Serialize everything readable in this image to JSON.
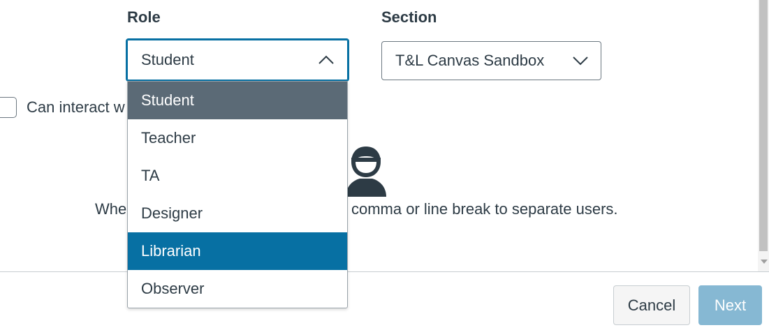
{
  "form": {
    "role_label": "Role",
    "section_label": "Section",
    "role_value": "Student",
    "section_value": "T&L Canvas Sandbox",
    "checkbox_label": "Can interact w",
    "instruction_left": "Whe",
    "instruction_right": "comma or line break to separate users."
  },
  "role_menu": {
    "options": [
      "Student",
      "Teacher",
      "TA",
      "Designer",
      "Librarian",
      "Observer"
    ],
    "selected": "Student",
    "highlighted": "Librarian"
  },
  "footer": {
    "cancel_label": "Cancel",
    "next_label": "Next"
  },
  "colors": {
    "accent": "#0770a3",
    "selected_bg": "#5b6a76",
    "next_disabled_bg": "#86b8d3",
    "text": "#2d3b45"
  },
  "icons": {
    "user_silhouette": "user-silhouette-icon",
    "chevron_up": "chevron-up-icon",
    "chevron_down": "chevron-down-icon"
  }
}
